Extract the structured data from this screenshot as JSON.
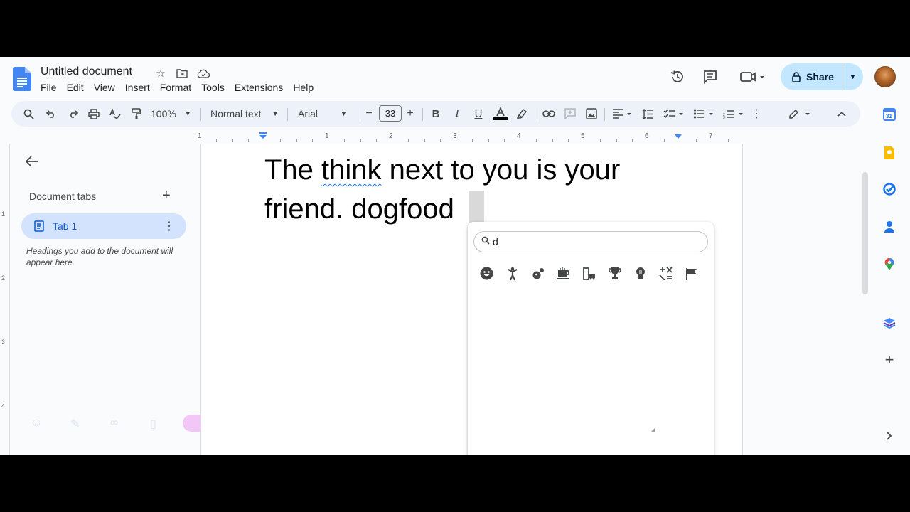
{
  "header": {
    "title": "Untitled document",
    "menu": [
      "File",
      "Edit",
      "View",
      "Insert",
      "Format",
      "Tools",
      "Extensions",
      "Help"
    ],
    "share_label": "Share"
  },
  "toolbar": {
    "zoom": "100%",
    "style": "Normal text",
    "font": "Arial",
    "font_size": "33"
  },
  "ruler": {
    "marks": [
      "1",
      "1",
      "2",
      "3",
      "4",
      "5",
      "6",
      "7"
    ]
  },
  "vruler": {
    "marks": [
      "1",
      "2",
      "3",
      "4"
    ]
  },
  "sidebar": {
    "section_label": "Document tabs",
    "tab_label": "Tab 1",
    "hint": "Headings you add to the document will appear here."
  },
  "document": {
    "line1_pre": "The ",
    "line1_word": "think",
    "line1_post": " next to you is your",
    "line2": "friend. dogfood"
  },
  "emoji_picker": {
    "search_query": "d",
    "emojis": [
      "😓",
      "😫",
      "😵‍💫",
      "😌",
      "🥸"
    ]
  }
}
